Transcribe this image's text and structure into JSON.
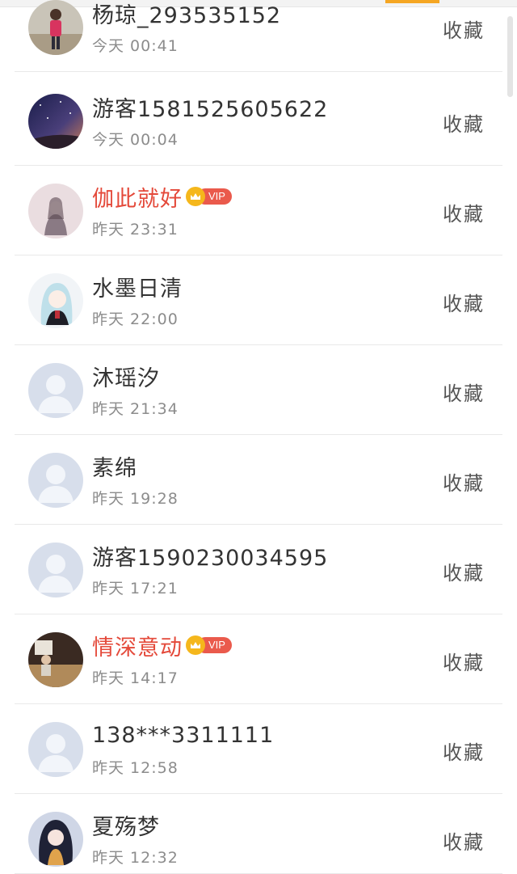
{
  "colors": {
    "accent": "#f5a623",
    "vip_name": "#e4493a",
    "vip_badge": "#ea5a4c",
    "crown": "#f5b71c",
    "name": "#333333",
    "time": "#8c8c8c"
  },
  "list": {
    "rows": [
      {
        "name": "杨琼_293535152",
        "time": "今天 00:41",
        "vip": false,
        "avatar": "photo-girl",
        "fav": "收藏"
      },
      {
        "name": "游客1581525605622",
        "time": "今天 00:04",
        "vip": false,
        "avatar": "starry-sky",
        "fav": "收藏"
      },
      {
        "name": "伽此就好",
        "time": "昨天 23:31",
        "vip": true,
        "vip_label": "VIP",
        "avatar": "illustration-girl",
        "fav": "收藏"
      },
      {
        "name": "水墨日清",
        "time": "昨天 22:00",
        "vip": false,
        "avatar": "anime-girl",
        "fav": "收藏"
      },
      {
        "name": "沐瑶汐",
        "time": "昨天 21:34",
        "vip": false,
        "avatar": "default",
        "fav": "收藏"
      },
      {
        "name": "素绵",
        "time": "昨天 19:28",
        "vip": false,
        "avatar": "default",
        "fav": "收藏"
      },
      {
        "name": "游客1590230034595",
        "time": "昨天 17:21",
        "vip": false,
        "avatar": "default",
        "fav": "收藏"
      },
      {
        "name": "情深意动",
        "time": "昨天 14:17",
        "vip": true,
        "vip_label": "VIP",
        "avatar": "photo-room",
        "fav": "收藏"
      },
      {
        "name": "138***3311111",
        "time": "昨天 12:58",
        "vip": false,
        "avatar": "default",
        "fav": "收藏"
      },
      {
        "name": "夏殇梦",
        "time": "昨天 12:32",
        "vip": false,
        "avatar": "anime-dark",
        "fav": "收藏"
      }
    ]
  }
}
